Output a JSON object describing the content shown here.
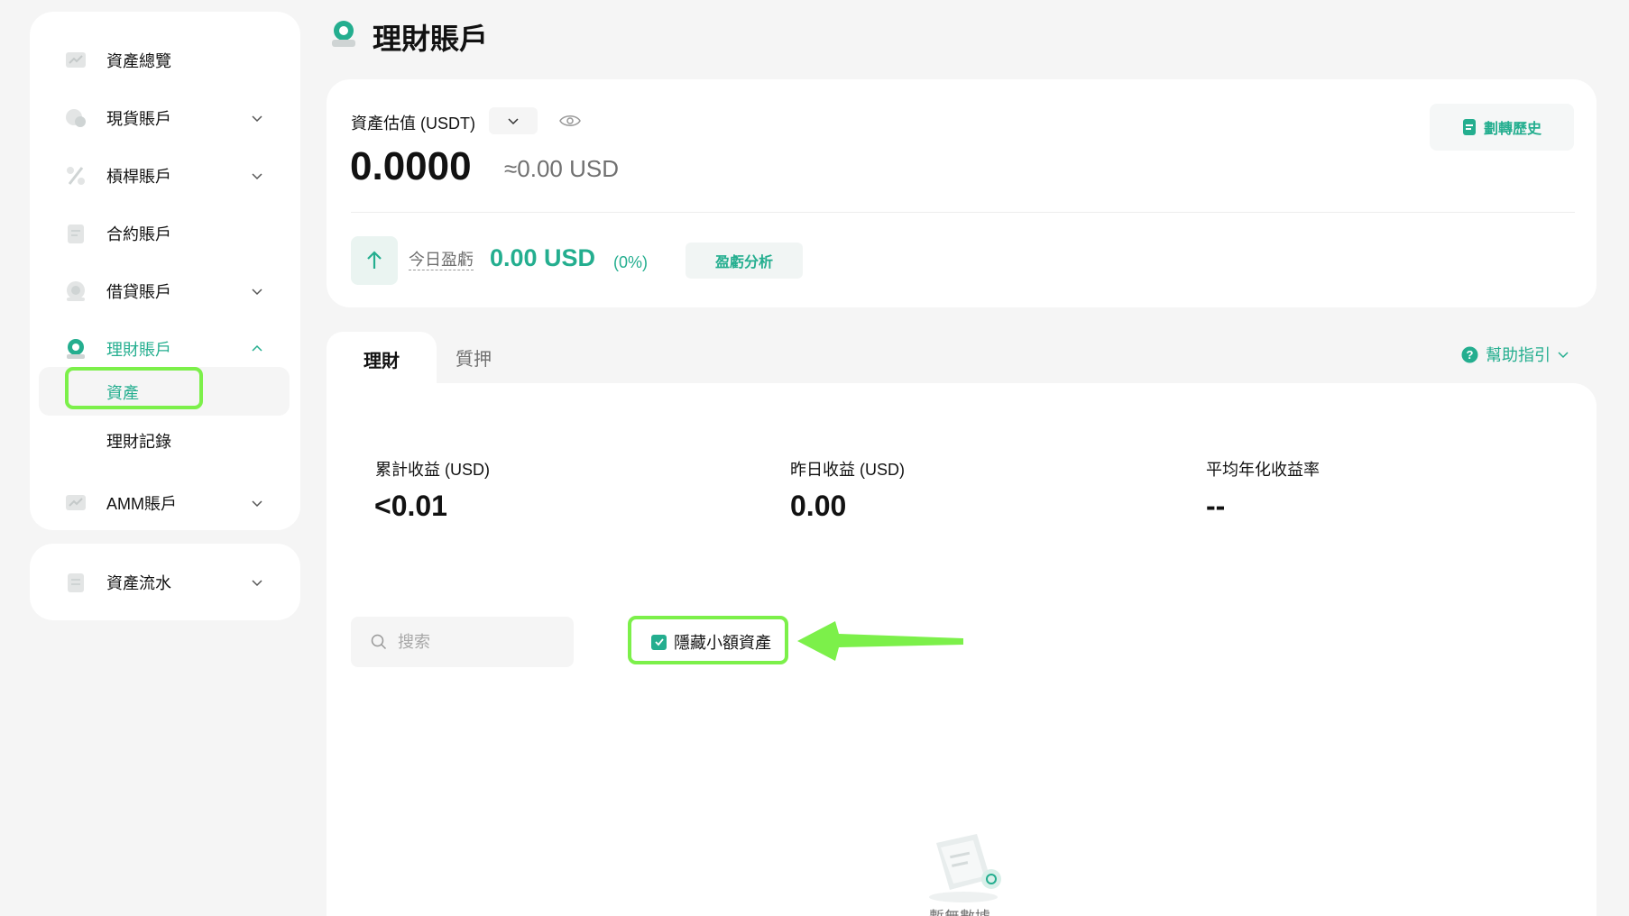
{
  "page": {
    "title": "理財賬戶"
  },
  "sidebar": {
    "items": [
      {
        "label": "資產總覽",
        "icon": "chart-icon",
        "expandable": false
      },
      {
        "label": "現貨賬戶",
        "icon": "coins-icon",
        "expandable": true
      },
      {
        "label": "槓桿賬戶",
        "icon": "percent-icon",
        "expandable": true
      },
      {
        "label": "合約賬戶",
        "icon": "contract-icon",
        "expandable": false
      },
      {
        "label": "借貸賬戶",
        "icon": "loan-icon",
        "expandable": true
      },
      {
        "label": "理財賬戶",
        "icon": "earn-icon",
        "expandable": true,
        "expanded": true,
        "active": true
      },
      {
        "label": "AMM賬戶",
        "icon": "amm-icon",
        "expandable": true
      }
    ],
    "sub_items": [
      {
        "label": "資產",
        "active": true
      },
      {
        "label": "理財記錄",
        "active": false
      }
    ],
    "flow": {
      "label": "資產流水",
      "icon": "ledger-icon"
    }
  },
  "summary": {
    "est_label": "資產估值 (USDT)",
    "balance": "0.0000",
    "approx": "≈0.00 USD",
    "history_button": "劃轉歷史",
    "today_pnl_label": "今日盈虧",
    "today_pnl_value": "0.00 USD",
    "today_pnl_pct": "(0%)",
    "analysis_button": "盈虧分析"
  },
  "tabs": [
    {
      "label": "理財",
      "active": true
    },
    {
      "label": "質押",
      "active": false
    }
  ],
  "help": {
    "label": "幫助指引"
  },
  "stats": [
    {
      "label": "累計收益 (USD)",
      "value": "<0.01"
    },
    {
      "label": "昨日收益 (USD)",
      "value": "0.00"
    },
    {
      "label": "平均年化收益率",
      "value": "--"
    }
  ],
  "filters": {
    "search_placeholder": "搜索",
    "hide_small_label": "隱藏小額資產",
    "hide_small_checked": true
  },
  "empty": {
    "text": "暫無數據"
  },
  "colors": {
    "accent": "#24ae8f",
    "highlight": "#7cf04a",
    "background": "#f5f5f5"
  }
}
